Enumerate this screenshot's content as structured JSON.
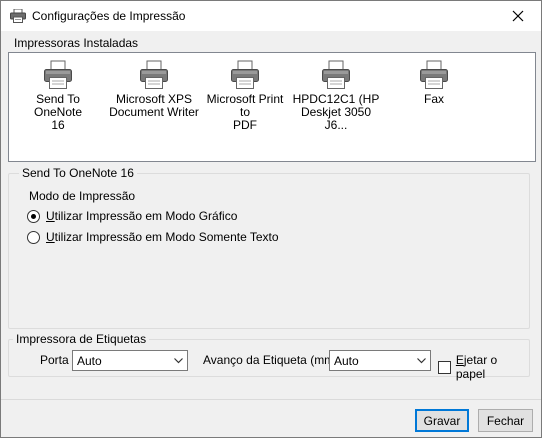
{
  "window": {
    "title": "Configurações de Impressão",
    "close_symbol": "✕"
  },
  "installed": {
    "label": "Impressoras Instaladas",
    "printers": [
      {
        "name_line1": "Send To OneNote",
        "name_line2": "16"
      },
      {
        "name_line1": "Microsoft XPS",
        "name_line2": "Document Writer"
      },
      {
        "name_line1": "Microsoft Print to",
        "name_line2": "PDF"
      },
      {
        "name_line1": "HPDC12C1 (HP",
        "name_line2": "Deskjet 3050 J6..."
      },
      {
        "name_line1": "Fax",
        "name_line2": ""
      }
    ]
  },
  "selected_printer": {
    "title": "Send To OneNote 16",
    "mode_label": "Modo de Impressão",
    "options": [
      {
        "access_key": "U",
        "rest": "tilizar Impressão em Modo Gráfico",
        "checked": true
      },
      {
        "access_key": "U",
        "rest": "tilizar Impressão em Modo Somente Texto",
        "checked": false
      }
    ]
  },
  "labels": {
    "title": "Impressora de Etiquetas",
    "porta_label": "Porta",
    "porta_value": "Auto",
    "avanco_label": "Avanço da Etiqueta (mm)",
    "avanco_value": "Auto",
    "eject_access_key": "E",
    "eject_rest": "jetar o papel",
    "eject_checked": false
  },
  "buttons": {
    "save": "Gravar",
    "close": "Fechar"
  },
  "colors": {
    "window_bg": "#f0f0f0",
    "list_bg": "#ffffff",
    "default_button_border": "#0078d7"
  }
}
